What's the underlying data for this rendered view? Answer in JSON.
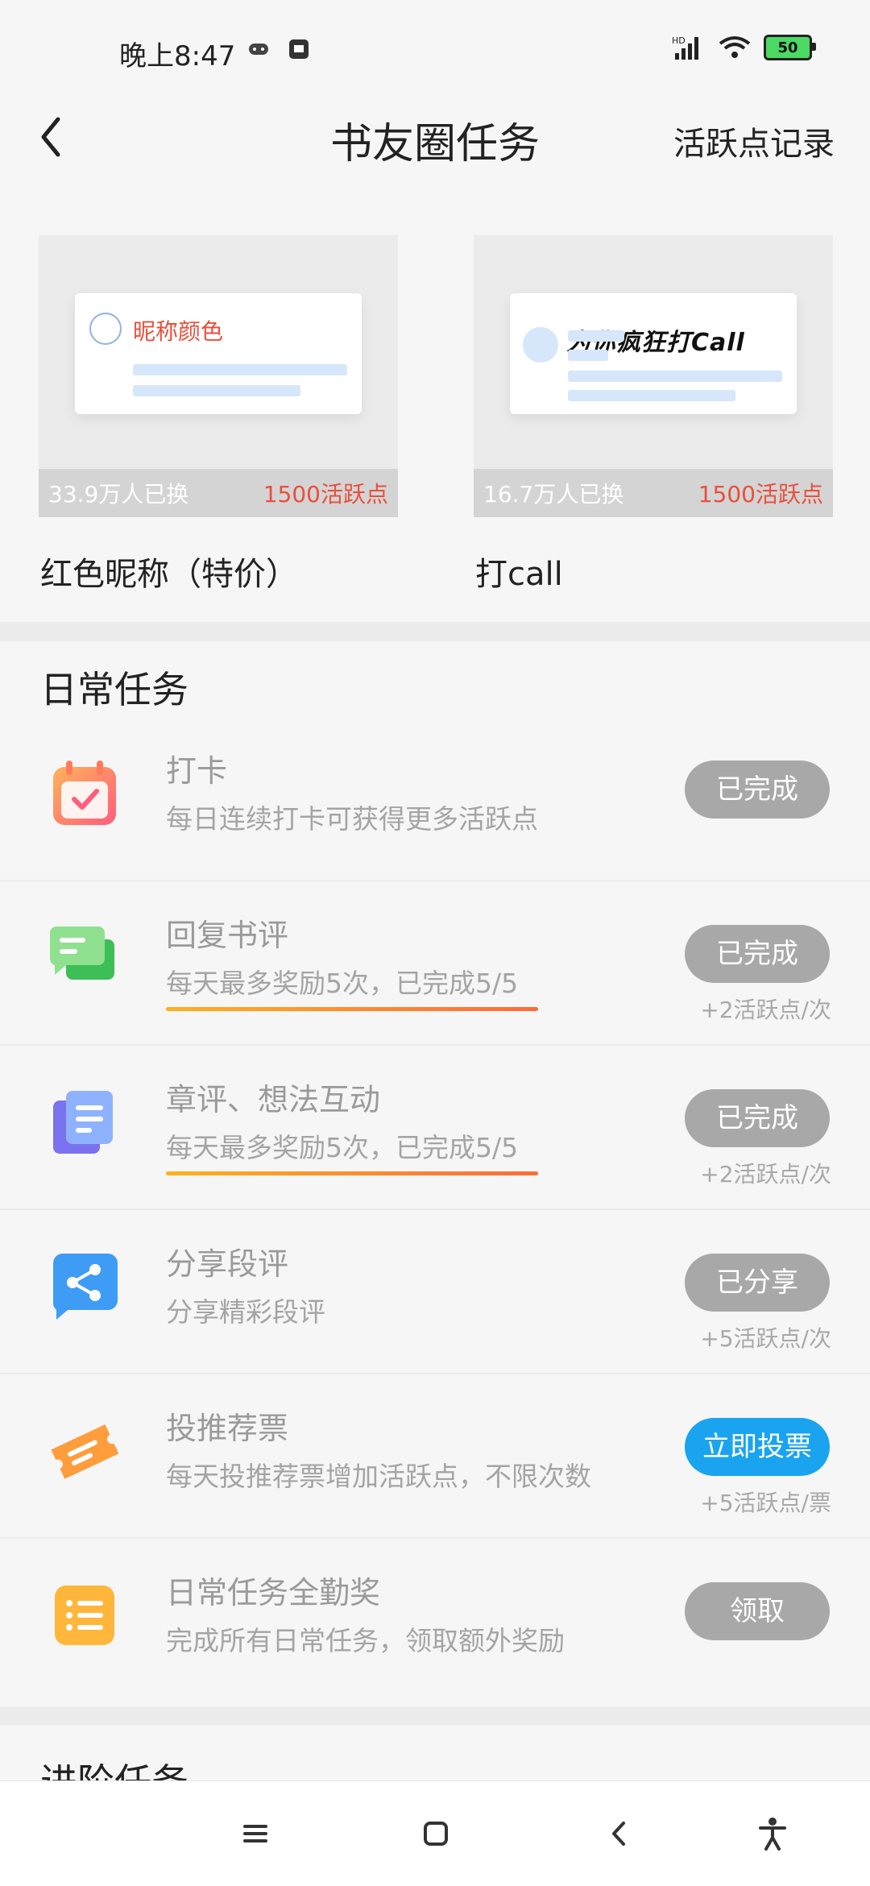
{
  "status_bar": {
    "time": "晚上8:47",
    "battery": "50"
  },
  "header": {
    "title": "书友圈任务",
    "record_link": "活跃点记录"
  },
  "rewards": [
    {
      "preview_label": "昵称颜色",
      "count": "33.9万人已换",
      "cost": "1500活跃点",
      "name": "红色昵称（特价）"
    },
    {
      "preview_label": "为你疯狂打Call",
      "count": "16.7万人已换",
      "cost": "1500活跃点",
      "name": "打call"
    }
  ],
  "daily": {
    "title": "日常任务",
    "tasks": [
      {
        "title": "打卡",
        "desc": "每日连续打卡可获得更多活跃点",
        "button": "已完成",
        "reward": ""
      },
      {
        "title": "回复书评",
        "desc": "每天最多奖励5次，已完成5/5",
        "button": "已完成",
        "reward": "+2活跃点/次"
      },
      {
        "title": "章评、想法互动",
        "desc": "每天最多奖励5次，已完成5/5",
        "button": "已完成",
        "reward": "+2活跃点/次"
      },
      {
        "title": "分享段评",
        "desc": "分享精彩段评",
        "button": "已分享",
        "reward": "+5活跃点/次"
      },
      {
        "title": "投推荐票",
        "desc": "每天投推荐票增加活跃点，不限次数",
        "button": "立即投票",
        "reward": "+5活跃点/票"
      },
      {
        "title": "日常任务全勤奖",
        "desc": "完成所有日常任务，领取额外奖励",
        "button": "领取",
        "reward": ""
      }
    ]
  },
  "advanced": {
    "title": "进阶任务"
  },
  "colors": {
    "accent_blue": "#1aa4f0",
    "done_gray": "#a8a8a8",
    "cost_red": "#e94f3c"
  }
}
